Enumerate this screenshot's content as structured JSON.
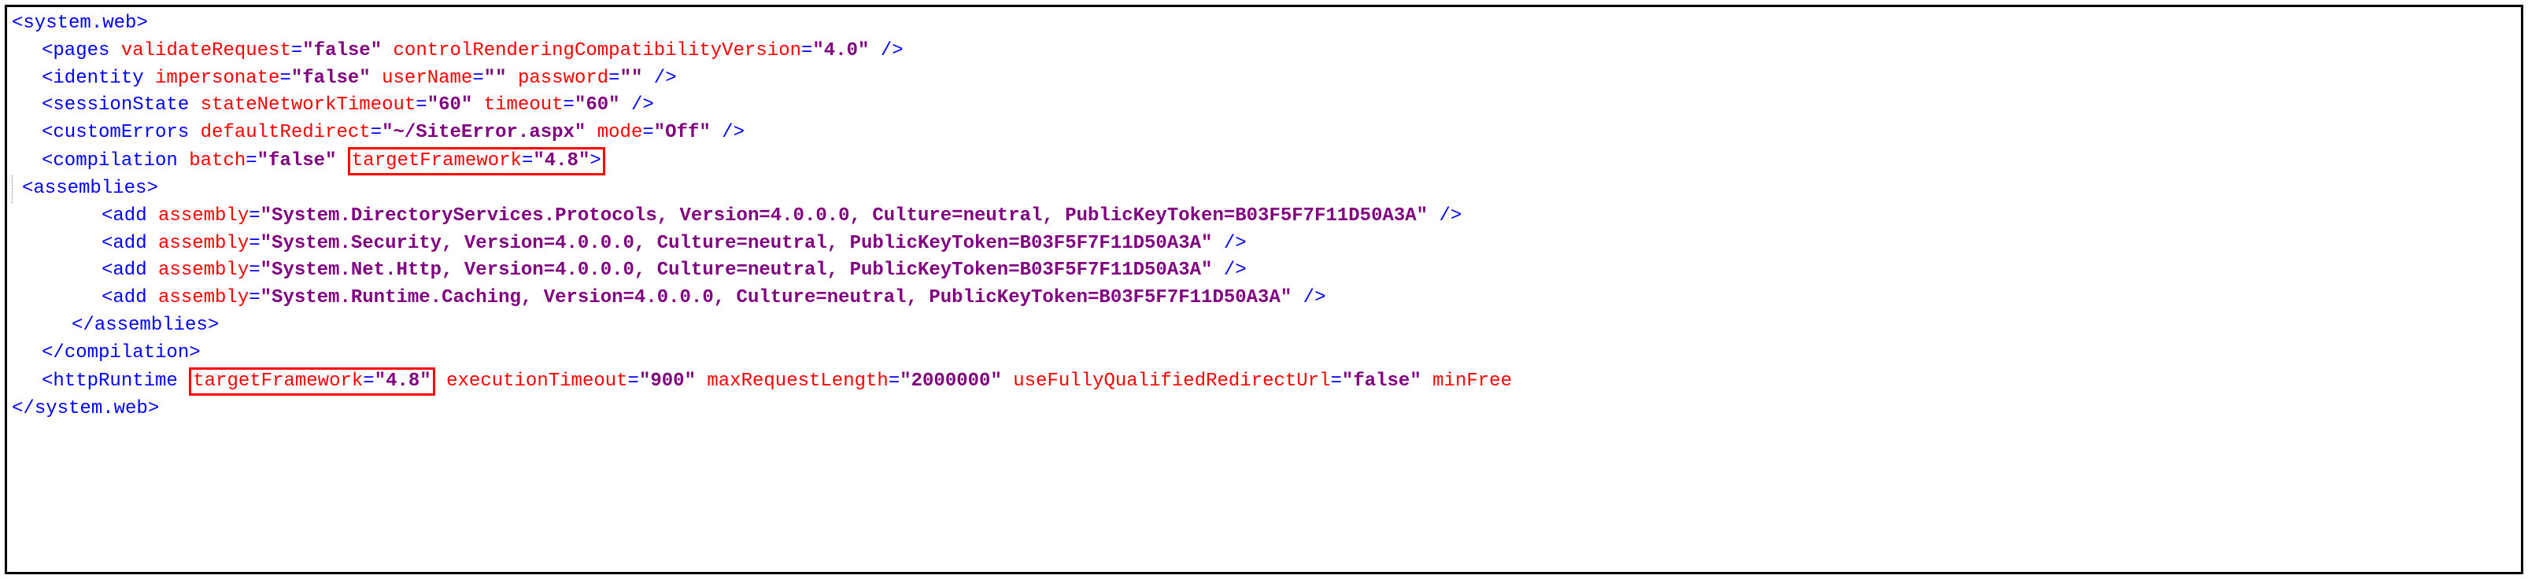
{
  "lines": {
    "l1": {
      "t0": "<",
      "t1": "system.web",
      "t2": ">"
    },
    "l2": {
      "t0": "<",
      "t1": "pages ",
      "a0": "validateRequest",
      "e0": "=",
      "v0": "\"false\"",
      "s0": " ",
      "a1": "controlRenderingCompatibilityVersion",
      "e1": "=",
      "v1": "\"4.0\"",
      "t2": " />"
    },
    "l3": {
      "t0": "<",
      "t1": "identity ",
      "a0": "impersonate",
      "e0": "=",
      "v0": "\"false\"",
      "s0": " ",
      "a1": "userName",
      "e1": "=",
      "v1": "\"\"",
      "s1": " ",
      "a2": "password",
      "e2": "=",
      "v2": "\"\"",
      "t2": " />"
    },
    "l4": {
      "t0": "<",
      "t1": "sessionState ",
      "a0": "stateNetworkTimeout",
      "e0": "=",
      "v0": "\"60\"",
      "s0": " ",
      "a1": "timeout",
      "e1": "=",
      "v1": "\"60\"",
      "t2": " />"
    },
    "l5": {
      "t0": "<",
      "t1": "customErrors ",
      "a0": "defaultRedirect",
      "e0": "=",
      "v0": "\"~/SiteError.aspx\"",
      "s0": " ",
      "a1": "mode",
      "e1": "=",
      "v1": "\"Off\"",
      "t2": " />"
    },
    "l6": {
      "t0": "<",
      "t1": "compilation ",
      "a0": "batch",
      "e0": "=",
      "v0": "\"false\"",
      "s0": " ",
      "hl_a": "targetFramework",
      "hl_e": "=",
      "hl_v": "\"4.8\"",
      "hl_close": ">"
    },
    "l7": {
      "t0": "<",
      "t1": "assemblies",
      "t2": ">"
    },
    "l8": {
      "t0": "<",
      "t1": "add ",
      "a0": "assembly",
      "e0": "=",
      "v0": "\"System.DirectoryServices.Protocols, Version=4.0.0.0, Culture=neutral, PublicKeyToken=B03F5F7F11D50A3A\"",
      "t2": " />"
    },
    "l9": {
      "t0": "<",
      "t1": "add ",
      "a0": "assembly",
      "e0": "=",
      "v0": "\"System.Security, Version=4.0.0.0, Culture=neutral, PublicKeyToken=B03F5F7F11D50A3A\"",
      "t2": " />"
    },
    "l10": {
      "t0": "<",
      "t1": "add ",
      "a0": "assembly",
      "e0": "=",
      "v0": "\"System.Net.Http, Version=4.0.0.0, Culture=neutral, PublicKeyToken=B03F5F7F11D50A3A\"",
      "t2": " />"
    },
    "l11": {
      "t0": "<",
      "t1": "add ",
      "a0": "assembly",
      "e0": "=",
      "v0": "\"System.Runtime.Caching, Version=4.0.0.0, Culture=neutral, PublicKeyToken=B03F5F7F11D50A3A\"",
      "t2": " />"
    },
    "l12": {
      "t0": "</",
      "t1": "assemblies",
      "t2": ">"
    },
    "l13": {
      "t0": "</",
      "t1": "compilation",
      "t2": ">"
    },
    "l14": {
      "t0": "<",
      "t1": "httpRuntime ",
      "hl_a": "targetFramework",
      "hl_e": "=",
      "hl_v": "\"4.8\"",
      "s0": " ",
      "a1": "executionTimeout",
      "e1": "=",
      "v1": "\"900\"",
      "s1": " ",
      "a2": "maxRequestLength",
      "e2": "=",
      "v2": "\"2000000\"",
      "s2": " ",
      "a3": "useFullyQualifiedRedirectUrl",
      "e3": "=",
      "v3": "\"false\"",
      "s3": " ",
      "a4": "minFree"
    },
    "l15": {
      "t0": "</",
      "t1": "system.web",
      "t2": ">"
    }
  }
}
